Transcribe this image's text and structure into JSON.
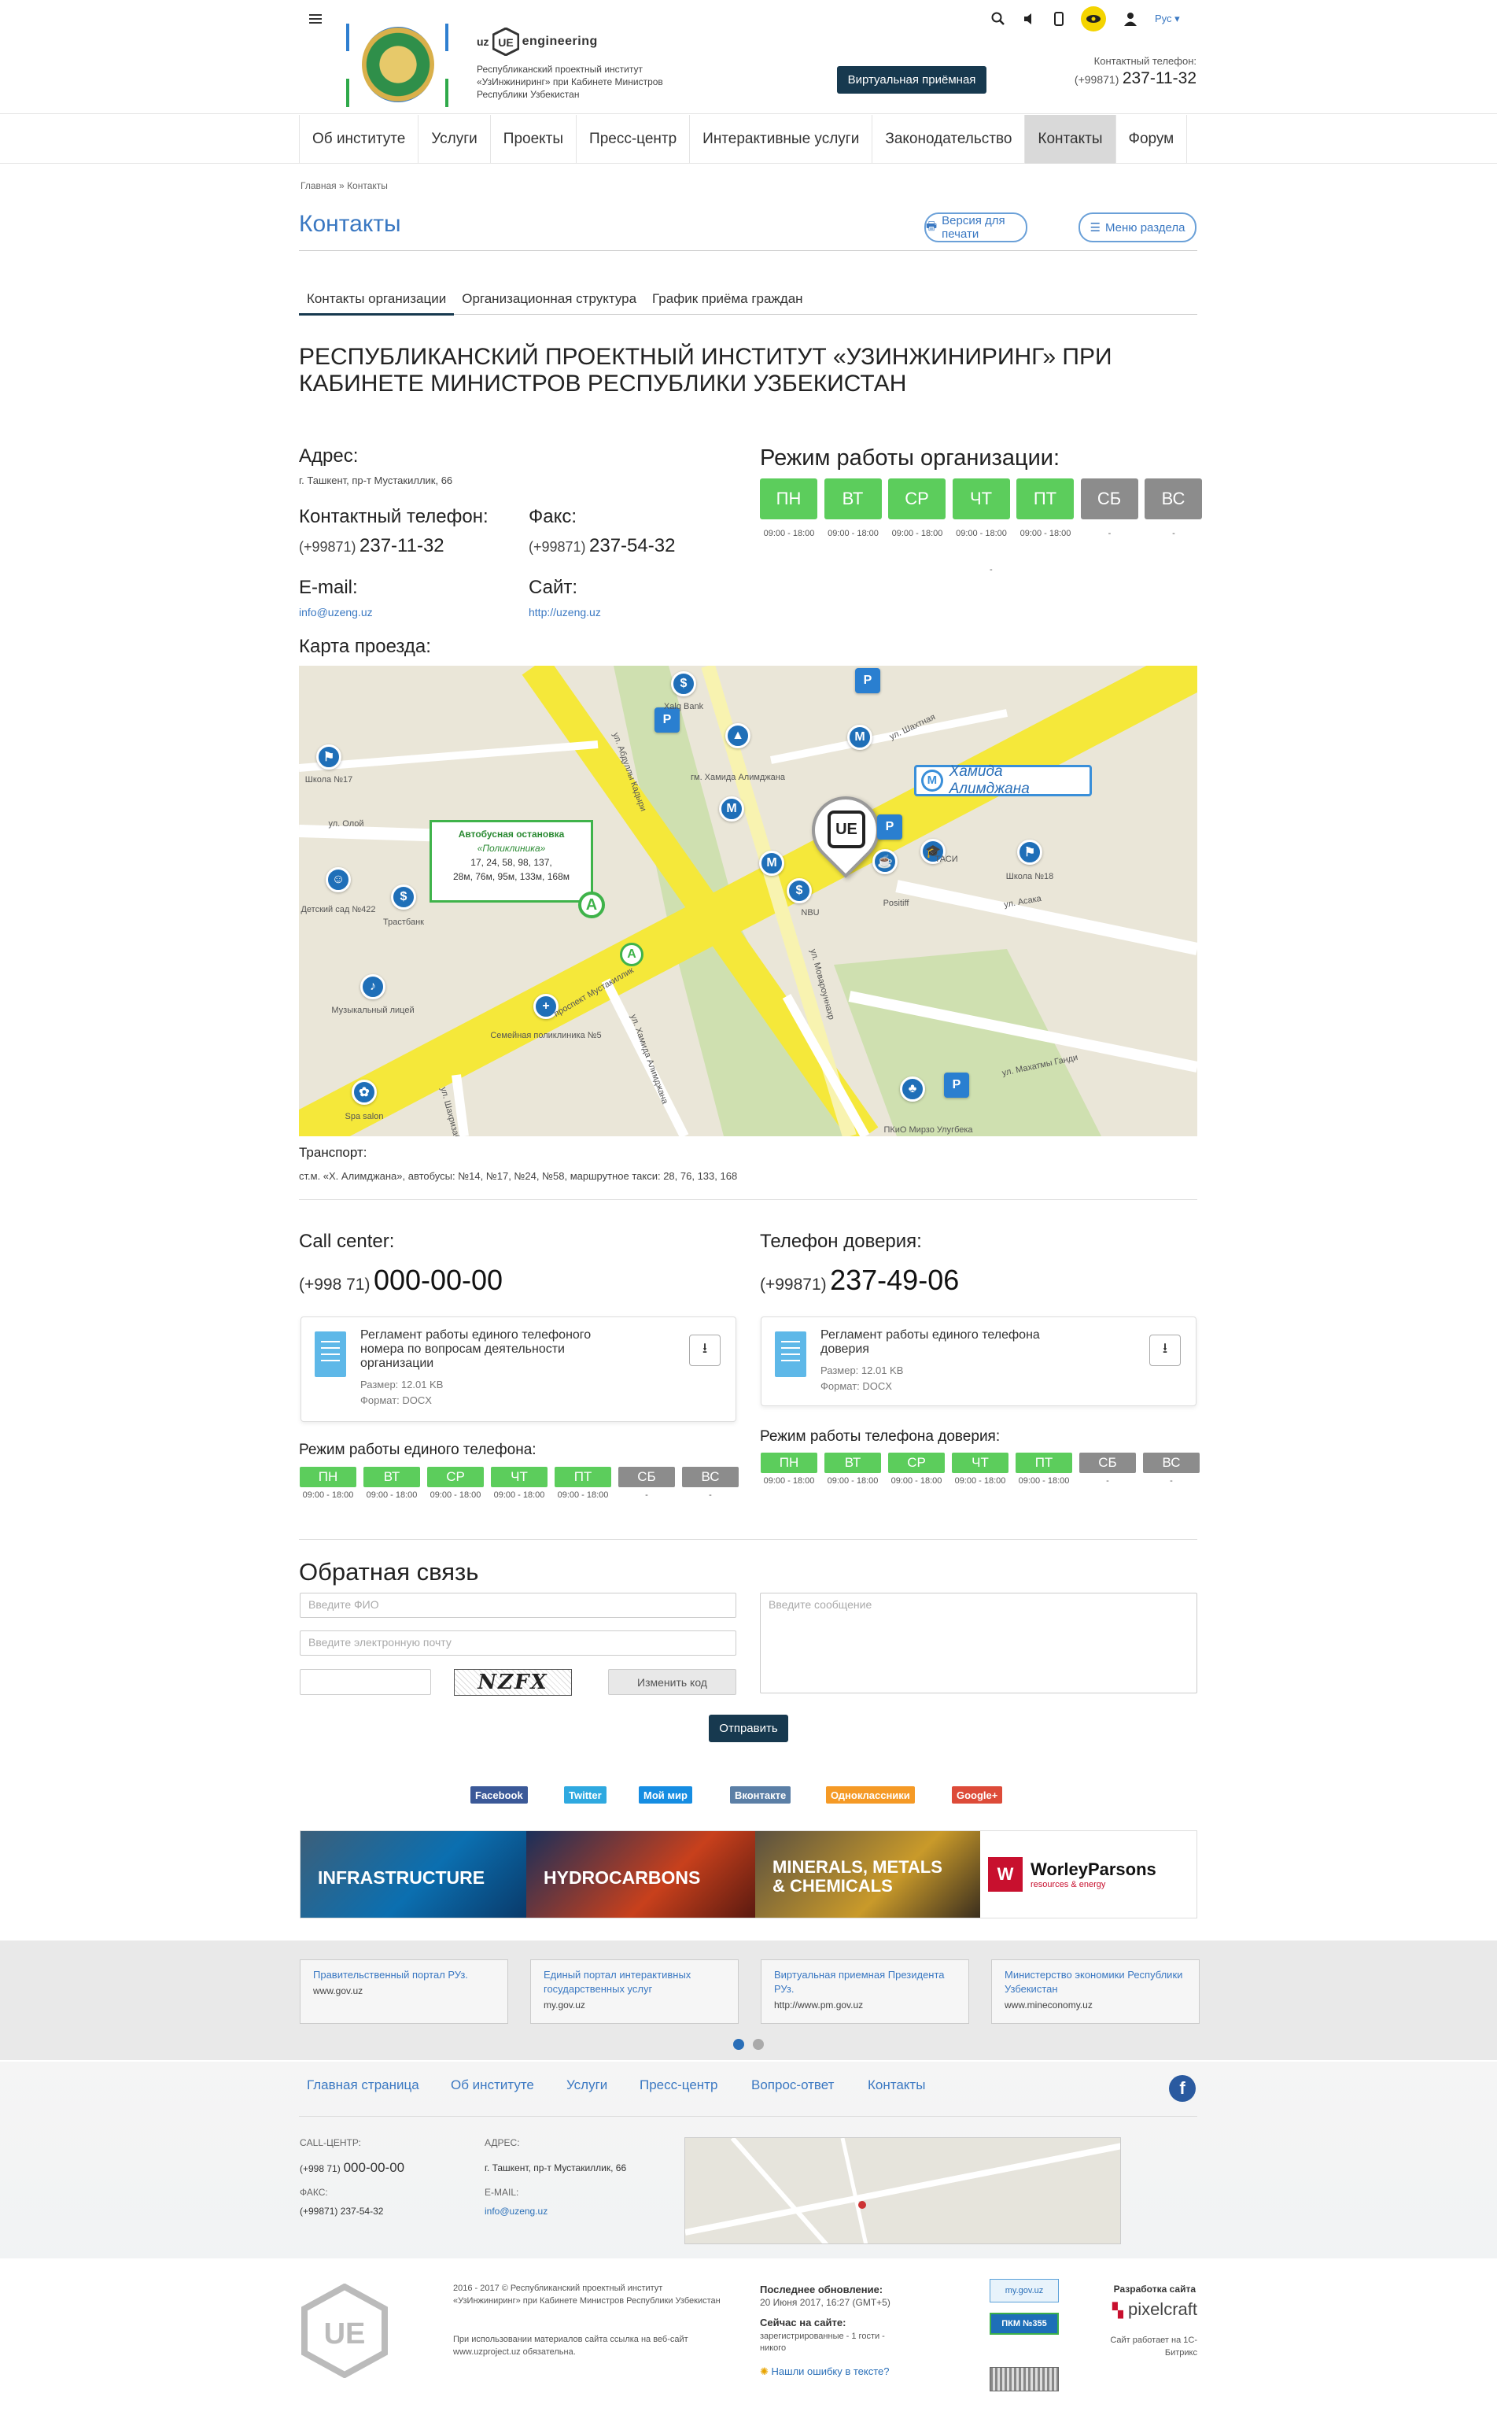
{
  "header": {
    "brand_top": "uz",
    "brand_name": "engineering",
    "brand_subtitle": "Республиканский проектный институт «УзИнжиниринг» при Кабинете Министров Республики Узбекистан",
    "virtual_reception": "Виртуальная приёмная",
    "phone_label": "Контактный телефон:",
    "phone_prefix": "(+99871)",
    "phone_number": "237-11-32",
    "lang": "Рус"
  },
  "nav": {
    "items": [
      {
        "label": "Об институте"
      },
      {
        "label": "Услуги"
      },
      {
        "label": "Проекты"
      },
      {
        "label": "Пресс-центр"
      },
      {
        "label": "Интерактивные услуги"
      },
      {
        "label": "Законодательство"
      },
      {
        "label": "Контакты"
      },
      {
        "label": "Форум"
      }
    ]
  },
  "breadcrumb": {
    "home": "Главная",
    "sep": "»",
    "current": "Контакты"
  },
  "page": {
    "title": "Контакты",
    "print_version": "Версия для печати",
    "section_menu": "Меню раздела"
  },
  "tabs": [
    {
      "label": "Контакты организации"
    },
    {
      "label": "Организационная структура"
    },
    {
      "label": "График приёма граждан"
    }
  ],
  "org": {
    "title_line1": "РЕСПУБЛИКАНСКИЙ ПРОЕКТНЫЙ ИНСТИТУТ «УЗИНЖИНИРИНГ» ПРИ",
    "title_line2": "КАБИНЕТЕ МИНИСТРОВ РЕСПУБЛИКИ УЗБЕКИСТАН",
    "address_label": "Адрес:",
    "address": "г. Ташкент, пр-т Мустакиллик, 66",
    "phone_label": "Контактный телефон:",
    "phone_prefix": "(+99871)",
    "phone": "237-11-32",
    "fax_label": "Факс:",
    "fax_prefix": "(+99871)",
    "fax": "237-54-32",
    "email_label": "E-mail:",
    "email": "info@uzeng.uz",
    "site_label": "Сайт:",
    "site": "http://uzeng.uz",
    "hours_title": "Режим работы организации:",
    "dash": "-"
  },
  "days": [
    {
      "d": "ПН",
      "h": "09:00 - 18:00",
      "on": true
    },
    {
      "d": "ВТ",
      "h": "09:00 - 18:00",
      "on": true
    },
    {
      "d": "СР",
      "h": "09:00 - 18:00",
      "on": true
    },
    {
      "d": "ЧТ",
      "h": "09:00 - 18:00",
      "on": true
    },
    {
      "d": "ПТ",
      "h": "09:00 - 18:00",
      "on": true
    },
    {
      "d": "СБ",
      "h": "-",
      "on": false
    },
    {
      "d": "ВС",
      "h": "-",
      "on": false
    }
  ],
  "map": {
    "label": "Карта проезда:",
    "bus_stop_title": "Автобусная остановка",
    "bus_stop_name": "«Поликлиника»",
    "bus_routes1": "17, 24, 58, 98, 137,",
    "bus_routes2": "28м, 76м, 95м, 133м, 168м",
    "metro_name": "Хамида Алимджана",
    "places": [
      "Xalq Bank",
      "гм. Хамида Алимджана",
      "Школа №17",
      "ул. Олой",
      "Детский сад №422",
      "Трастбанк",
      "Музыкальный лицей",
      "Семейная поликлиника №5",
      "Spa salon",
      "ТАСИ",
      "Школа №18",
      "ул. Асака",
      "Positiff",
      "NBU",
      "проспект Мустакиллик",
      "ул. Абдуллы Кадыри",
      "ул. Мовароуннахр",
      "ул. Махатмы Ганди",
      "ул. Шахризабская",
      "ПКиО Мирзо Улугбека",
      "ул. Хамида Алимджана",
      "ул. Шахтная"
    ],
    "transport_label": "Транспорт:",
    "transport_text": "ст.м. «Х. Алимджана», автобусы:  №14, №17, №24, №58, маршрутное такси: 28, 76, 133, 168"
  },
  "callcenter": {
    "title": "Call center:",
    "prefix": "(+998 71)",
    "number": "000-00-00",
    "doc_title": "Регламент работы единого телефоного номера по вопросам деятельности организации",
    "doc_size": "Размер: 12.01 KB",
    "doc_format": "Формат: DOCX",
    "hours_title": "Режим работы единого телефона:"
  },
  "trust": {
    "title": "Телефон доверия:",
    "prefix": "(+99871)",
    "number": "237-49-06",
    "doc_title": "Регламент работы единого телефона доверия",
    "doc_size": "Размер: 12.01 KB",
    "doc_format": "Формат: DOCX",
    "hours_title": "Режим работы телефона доверия:"
  },
  "feedback": {
    "title": "Обратная связь",
    "name_placeholder": "Введите ФИО",
    "email_placeholder": "Введите электронную почту",
    "message_placeholder": "Введите сообщение",
    "captcha_text": "NZFX",
    "change_code": "Изменить код",
    "submit": "Отправить"
  },
  "share": [
    {
      "label": "Facebook",
      "color": "#3b5998"
    },
    {
      "label": "Twitter",
      "color": "#2fa9e0"
    },
    {
      "label": "Мой мир",
      "color": "#168de2"
    },
    {
      "label": "Вконтакте",
      "color": "#5b7fa6"
    },
    {
      "label": "Одноклассники",
      "color": "#f59a26"
    },
    {
      "label": "Google+",
      "color": "#dd4b39"
    }
  ],
  "banner": {
    "items": [
      "INFRASTRUCTURE",
      "HYDROCARBONS",
      "MINERALS, METALS & CHEMICALS"
    ],
    "brand": "WorleyParsons",
    "brand_sub": "resources & energy"
  },
  "links": [
    {
      "t": "Правительственный портал РУз.",
      "u": "www.gov.uz"
    },
    {
      "t": "Единый портал интерактивных государственных услуг",
      "u": "my.gov.uz"
    },
    {
      "t": "Виртуальная приемная Президента РУз.",
      "u": "http://www.pm.gov.uz"
    },
    {
      "t": "Министерство экономики Республики Узбекистан",
      "u": "www.mineconomy.uz"
    }
  ],
  "footer": {
    "links": [
      "Главная страница",
      "Об институте",
      "Услуги",
      "Пресс-центр",
      "Вопрос-ответ",
      "Контакты"
    ],
    "call_label": "CALL-ЦЕНТР:",
    "call_prefix": "(+998 71)",
    "call_number": "000-00-00",
    "fax_label": "ФАКС:",
    "fax": "(+99871) 237-54-32",
    "address_label": "АДРЕС:",
    "address": "г. Ташкент, пр-т Мустакиллик, 66",
    "email_label": "E-MAIL:",
    "email": "info@uzeng.uz",
    "copyright": "2016 - 2017 © Республиканский проектный институт «УзИнжиниринг» при Кабинете Министров Республики Узбекистан",
    "copy_note": "При использовании материалов сайта ссылка на веб-сайт www.uzproject.uz обязательна.",
    "updated_label": "Последнее обновление:",
    "updated": "20 Июня 2017, 16:27 (GMT+5)",
    "online_label": "Сейчас на сайте:",
    "online": "зарегистрированные - 1 гости - никого",
    "typo": "Нашли ошибку в тексте?",
    "badge1": "my.gov.uz",
    "badge2": "ПКМ №355",
    "dev_label": "Разработка сайта",
    "dev": "pixelcraft",
    "bitrix": "Сайт работает на 1С-Битрикс"
  }
}
